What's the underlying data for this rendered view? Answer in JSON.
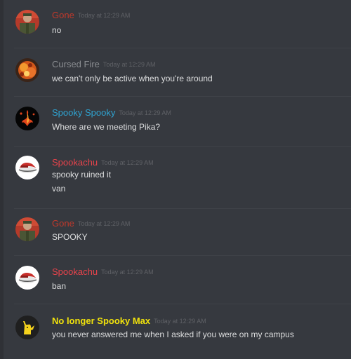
{
  "colors": {
    "background": "#36393f",
    "gone": "#c0392b",
    "cursed_fire": "#8a8d91",
    "spooky_spooky": "#2fa4d2",
    "spookachu": "#e8434b",
    "no_longer_spooky_max": "#f1e20c",
    "timestamp": "#5f6166",
    "text": "#dcddde"
  },
  "messages": [
    {
      "author": "Gone",
      "avatar_icon": "soldier-avatar-icon",
      "timestamp": "Today at 12:29 AM",
      "lines": [
        "no"
      ]
    },
    {
      "author": "Cursed Fire",
      "avatar_icon": "fire-avatar-icon",
      "timestamp": "Today at 12:29 AM",
      "lines": [
        "we can't only be active when you're around"
      ]
    },
    {
      "author": "Spooky Spooky",
      "avatar_icon": "flame-figure-avatar-icon",
      "timestamp": "Today at 12:29 AM",
      "lines": [
        "Where are we meeting Pika?"
      ]
    },
    {
      "author": "Spookachu",
      "avatar_icon": "pokeball-avatar-icon",
      "timestamp": "Today at 12:29 AM",
      "lines": [
        "spooky ruined it",
        "van"
      ]
    },
    {
      "author": "Gone",
      "avatar_icon": "soldier-avatar-icon",
      "timestamp": "Today at 12:29 AM",
      "lines": [
        "SPOOKY"
      ]
    },
    {
      "author": "Spookachu",
      "avatar_icon": "pokeball-avatar-icon",
      "timestamp": "Today at 12:29 AM",
      "lines": [
        "ban"
      ]
    },
    {
      "author": "No longer Spooky Max",
      "avatar_icon": "pikachu-silhouette-avatar-icon",
      "timestamp": "Today at 12:29 AM",
      "lines": [
        "you never answered me when I asked if you were on my campus"
      ]
    }
  ]
}
